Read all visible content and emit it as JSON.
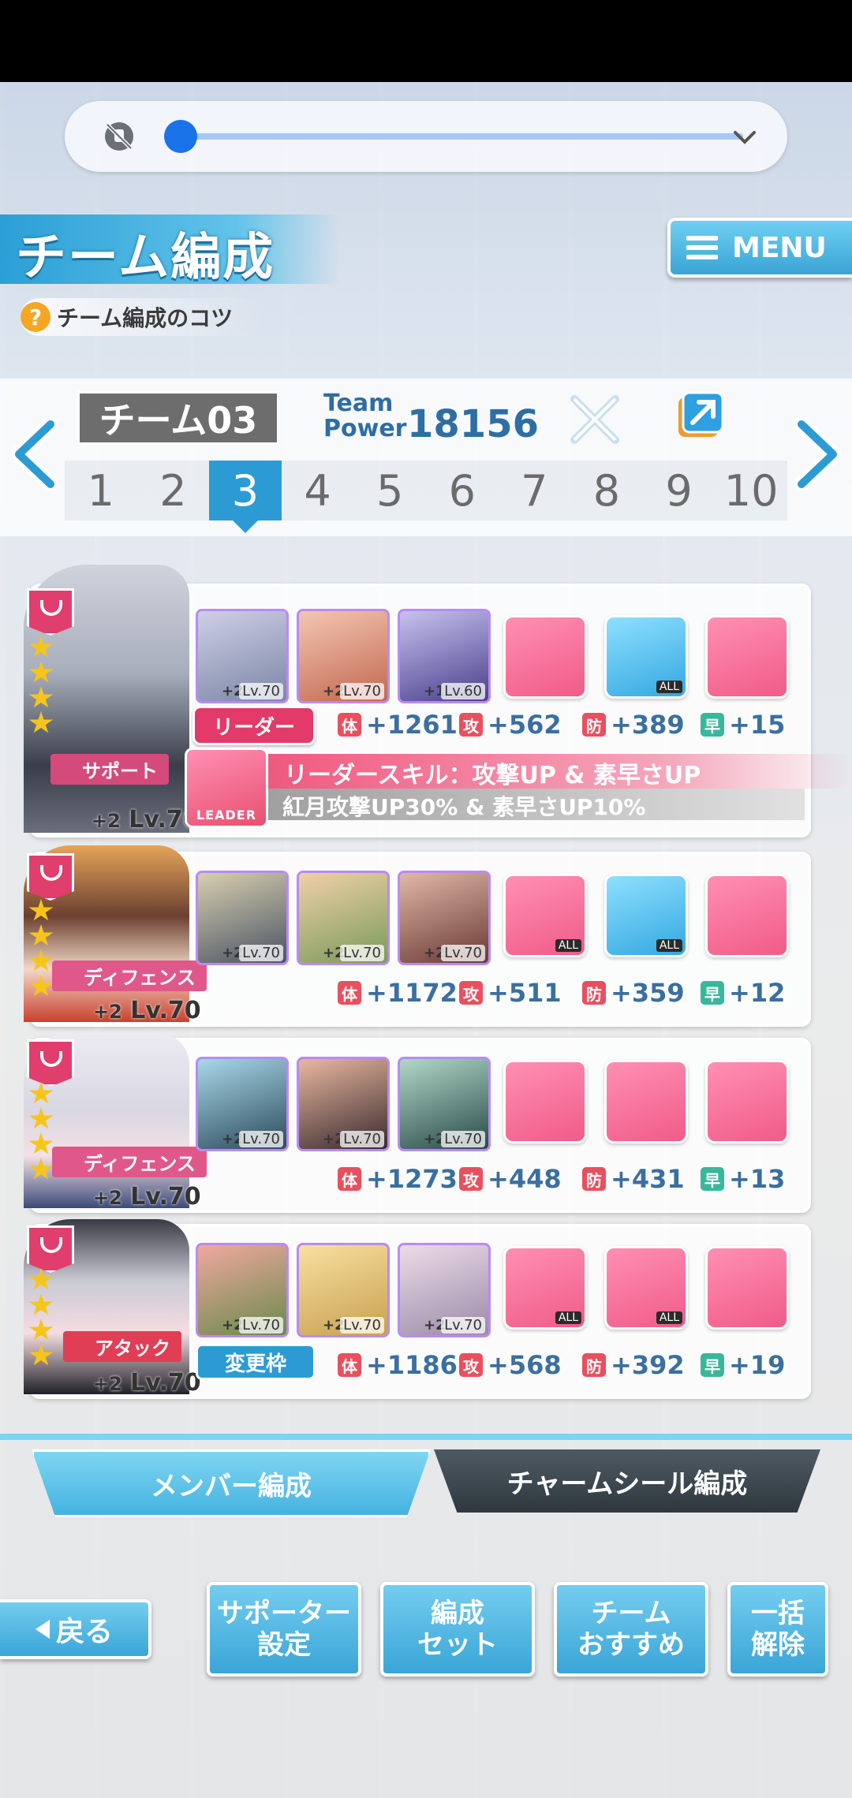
{
  "header": {
    "title": "チーム編成",
    "menu_label": "MENU",
    "tips_label": "チーム編成のコツ"
  },
  "team": {
    "name": "チーム03",
    "power_label_line1": "Team",
    "power_label_line2": "Power",
    "power_value": "18156",
    "tabs": [
      "1",
      "2",
      "3",
      "4",
      "5",
      "6",
      "7",
      "8",
      "9",
      "10"
    ],
    "active_tab": "3"
  },
  "rows": [
    {
      "role": "サポート",
      "plus": "+2",
      "level": "Lv.70",
      "cards": [
        {
          "plus": "+2",
          "lv": "Lv.70"
        },
        {
          "plus": "+2",
          "lv": "Lv.70"
        },
        {
          "plus": "+1",
          "lv": "Lv.60"
        }
      ],
      "leader_tag": "リーダー",
      "stats": {
        "hp": "+1261",
        "atk": "+562",
        "def": "+389",
        "spd": "+15"
      },
      "skill_all": [
        "",
        "ALL",
        ""
      ]
    },
    {
      "role": "ディフェンス",
      "plus": "+2",
      "level": "Lv.70",
      "cards": [
        {
          "plus": "+2",
          "lv": "Lv.70"
        },
        {
          "plus": "+2",
          "lv": "Lv.70"
        },
        {
          "plus": "+2",
          "lv": "Lv.70"
        }
      ],
      "stats": {
        "hp": "+1172",
        "atk": "+511",
        "def": "+359",
        "spd": "+12"
      },
      "skill_all": [
        "ALL",
        "ALL",
        ""
      ]
    },
    {
      "role": "ディフェンス",
      "plus": "+2",
      "level": "Lv.70",
      "cards": [
        {
          "plus": "+2",
          "lv": "Lv.70"
        },
        {
          "plus": "+2",
          "lv": "Lv.70"
        },
        {
          "plus": "+2",
          "lv": "Lv.70"
        }
      ],
      "stats": {
        "hp": "+1273",
        "atk": "+448",
        "def": "+431",
        "spd": "+13"
      },
      "skill_all": [
        "",
        "",
        ""
      ]
    },
    {
      "role": "アタック",
      "plus": "+2",
      "level": "Lv.70",
      "cards": [
        {
          "plus": "+2",
          "lv": "Lv.70"
        },
        {
          "plus": "+2",
          "lv": "Lv.70"
        },
        {
          "plus": "+2",
          "lv": "Lv.70"
        }
      ],
      "change_label": "変更枠",
      "stats": {
        "hp": "+1186",
        "atk": "+568",
        "def": "+392",
        "spd": "+19"
      },
      "skill_all": [
        "ALL",
        "ALL",
        ""
      ]
    }
  ],
  "stat_keys": {
    "hp": "体",
    "atk": "攻",
    "def": "防",
    "spd": "早"
  },
  "leader": {
    "icon_label": "LEADER",
    "skill_title": "リーダースキル：攻撃UP & 素早さUP",
    "skill_desc": "紅月攻撃UP30% & 素早さUP10%"
  },
  "bottom_tabs": {
    "member": "メンバー編成",
    "charm": "チャームシール編成"
  },
  "buttons": {
    "back": "戻る",
    "supporter": "サポーター\n設定",
    "formation_set": "編成\nセット",
    "recommend": "チーム\nおすすめ",
    "clear_all": "一括\n解除"
  },
  "colors": {
    "accent": "#2d9bd3",
    "pink": "#e33a6a",
    "media_blue": "#1a73e8"
  }
}
